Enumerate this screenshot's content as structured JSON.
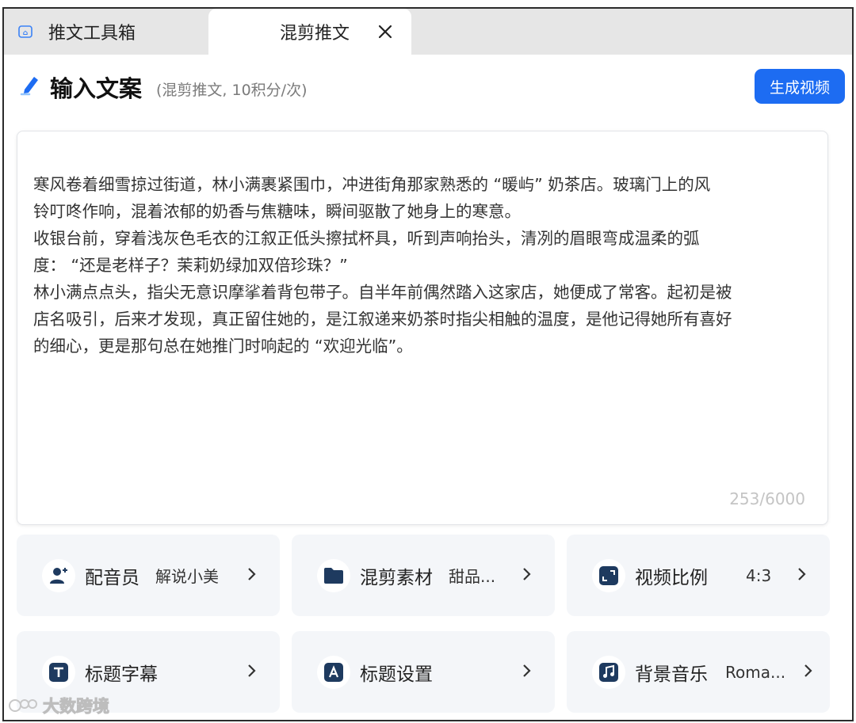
{
  "tabs": [
    {
      "label": "推文工具箱",
      "icon": "tool-icon",
      "active": false
    },
    {
      "label": "混剪推文",
      "active": true,
      "closable": true
    }
  ],
  "header": {
    "title": "输入文案",
    "subtitle": "(混剪推文, 10积分/次)",
    "generate_button": "生成视频"
  },
  "editor": {
    "text": "寒风卷着细雪掠过街道，林小满裹紧围巾，冲进街角那家熟悉的 “暖屿” 奶茶店。玻璃门上的风\n铃叮咚作响，混着浓郁的奶香与焦糖味，瞬间驱散了她身上的寒意。\n收银台前，穿着浅灰色毛衣的江叙正低头擦拭杯具，听到声响抬头，清冽的眉眼弯成温柔的弧\n度： “还是老样子？茉莉奶绿加双倍珍珠？”\n林小满点点头，指尖无意识摩挲着背包带子。自半年前偶然踏入这家店，她便成了常客。起初是被\n店名吸引，后来才发现，真正留住她的，是江叙递来奶茶时指尖相触的温度，是他记得她所有喜好\n的细心，更是那句总在她推门时响起的 “欢迎光临”。",
    "counter": "253/6000"
  },
  "settings": [
    {
      "label": "配音员",
      "value": "解说小美",
      "icon": "voice-actor-icon"
    },
    {
      "label": "混剪素材",
      "value": "甜品...",
      "icon": "folder-icon"
    },
    {
      "label": "视频比例",
      "value": "4:3",
      "icon": "aspect-ratio-icon"
    },
    {
      "label": "标题字幕",
      "value": "",
      "icon": "subtitle-icon"
    },
    {
      "label": "标题设置",
      "value": "",
      "icon": "title-settings-icon"
    },
    {
      "label": "背景音乐",
      "value": "Roma...",
      "icon": "music-icon"
    }
  ],
  "watermark": "大数跨境",
  "colors": {
    "accent": "#1d6cf2",
    "icon_dark": "#1e3a5f",
    "card_bg": "#f4f6f9"
  }
}
